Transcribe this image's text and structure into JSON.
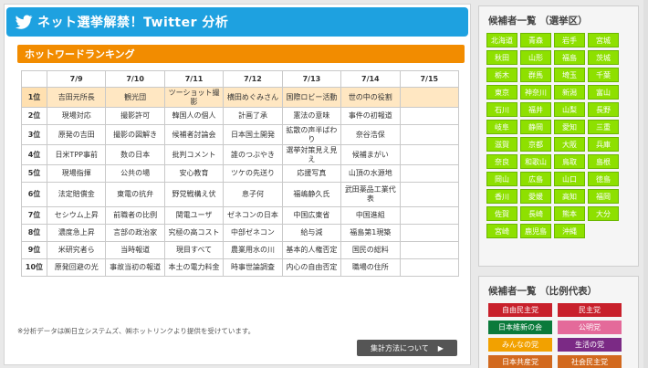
{
  "header": {
    "title": "ネット選挙解禁！Twitter 分析"
  },
  "ranking": {
    "title": "ホットワードランキング",
    "columns": [
      "",
      "7/9",
      "7/10",
      "7/11",
      "7/12",
      "7/13",
      "7/14",
      "7/15"
    ],
    "rows": [
      {
        "pos": "1位",
        "cells": [
          "吉田元所長",
          "観光団",
          "ツーショット撮影",
          "横田めぐみさん",
          "国際ロビー活動",
          "世の中の役割",
          ""
        ]
      },
      {
        "pos": "2位",
        "cells": [
          "現場対応",
          "撮影許可",
          "韓国人の個人",
          "計画了承",
          "憲法の意味",
          "事件の初報道",
          ""
        ]
      },
      {
        "pos": "3位",
        "cells": [
          "原発の吉田",
          "撮影の図解き",
          "候補者討論会",
          "日本国土開発",
          "拡散の声半ばわり",
          "奈谷浩保",
          ""
        ]
      },
      {
        "pos": "4位",
        "cells": [
          "日米TPP事前",
          "数の日本",
          "批判コメント",
          "誰のつぶやき",
          "選挙対策見え見え",
          "候補まがい",
          ""
        ]
      },
      {
        "pos": "5位",
        "cells": [
          "現場指揮",
          "公共の場",
          "安心教育",
          "ツケの先送り",
          "応援写真",
          "山頂の水源地",
          ""
        ]
      },
      {
        "pos": "6位",
        "cells": [
          "法定賠償金",
          "東電の抗弁",
          "野党戦構え伏",
          "息子何",
          "福嶋静久氏",
          "武田薬品工業代表",
          ""
        ]
      },
      {
        "pos": "7位",
        "cells": [
          "セシウム上昇",
          "前職者の比例",
          "関電ユーザ",
          "ゼネコンの日本",
          "中国広東省",
          "中国進組",
          ""
        ]
      },
      {
        "pos": "8位",
        "cells": [
          "濃度急上昇",
          "言部の政治家",
          "究極の高コスト",
          "中部ゼネコン",
          "給与減",
          "福島第1現築",
          ""
        ]
      },
      {
        "pos": "9位",
        "cells": [
          "米研究者ら",
          "当時報道",
          "現目すべて",
          "農業用水の川",
          "基本的人権否定",
          "国民の総料",
          ""
        ]
      },
      {
        "pos": "10位",
        "cells": [
          "原発回避の光",
          "事故当初の報道",
          "本土の電力料金",
          "時事世論調査",
          "内心の自由否定",
          "職場の住所",
          ""
        ]
      }
    ]
  },
  "footnote": "※分析データは㈱日立システムズ、㈱ホットリンクより提供を受けています。",
  "method_button": "集計方法について",
  "candidates_district": {
    "title": "候補者一覧 （選挙区）",
    "prefectures": [
      "北海道",
      "青森",
      "岩手",
      "宮城",
      "秋田",
      "山形",
      "福島",
      "茨城",
      "栃木",
      "群馬",
      "埼玉",
      "千葉",
      "東京",
      "神奈川",
      "新潟",
      "富山",
      "石川",
      "福井",
      "山梨",
      "長野",
      "岐阜",
      "静岡",
      "愛知",
      "三重",
      "滋賀",
      "京都",
      "大阪",
      "兵庫",
      "奈良",
      "和歌山",
      "鳥取",
      "島根",
      "岡山",
      "広島",
      "山口",
      "徳島",
      "香川",
      "愛媛",
      "高知",
      "福岡",
      "佐賀",
      "長崎",
      "熊本",
      "大分",
      "宮崎",
      "鹿児島",
      "沖縄"
    ]
  },
  "candidates_proportional": {
    "title": "候補者一覧 （比例代表）",
    "parties": [
      {
        "name": "自由民主党",
        "color": "#c8202b"
      },
      {
        "name": "民主党",
        "color": "#c8202b"
      },
      {
        "name": "日本維新の会",
        "color": "#0b7a3b"
      },
      {
        "name": "公明党",
        "color": "#e46a9a"
      },
      {
        "name": "みんなの党",
        "color": "#f2a100"
      },
      {
        "name": "生活の党",
        "color": "#7b2a85"
      },
      {
        "name": "日本共産党",
        "color": "#d2691e"
      },
      {
        "name": "社会民主党",
        "color": "#d2691e"
      }
    ]
  }
}
